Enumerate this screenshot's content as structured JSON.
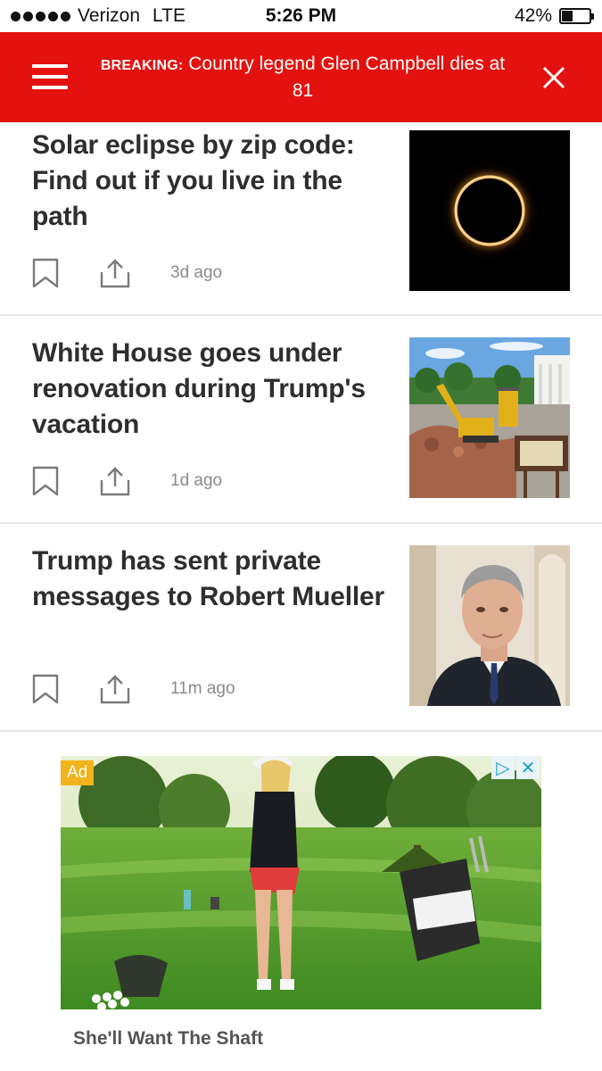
{
  "status_bar": {
    "carrier": "Verizon",
    "network": "LTE",
    "time": "5:26 PM",
    "battery": "42%",
    "battery_level": 0.42
  },
  "breaking": {
    "label": "BREAKING:",
    "text": "Country legend Glen Campbell dies at 81",
    "background_color": "#e3110f"
  },
  "articles": [
    {
      "headline": "Solar eclipse by zip code: Find out if you live in the path",
      "time_ago": "3d ago",
      "image": "solar-eclipse-image"
    },
    {
      "headline": "White House goes under renovation during Trump's vacation",
      "time_ago": "1d ago",
      "image": "white-house-construction-image"
    },
    {
      "headline": "Trump has sent private messages to Robert Mueller",
      "time_ago": "11m ago",
      "image": "robert-mueller-portrait-image"
    }
  ],
  "ad": {
    "badge": "Ad",
    "title": "She'll Want The Shaft",
    "choices_icons": [
      "adchoices-icon",
      "close-icon"
    ]
  }
}
